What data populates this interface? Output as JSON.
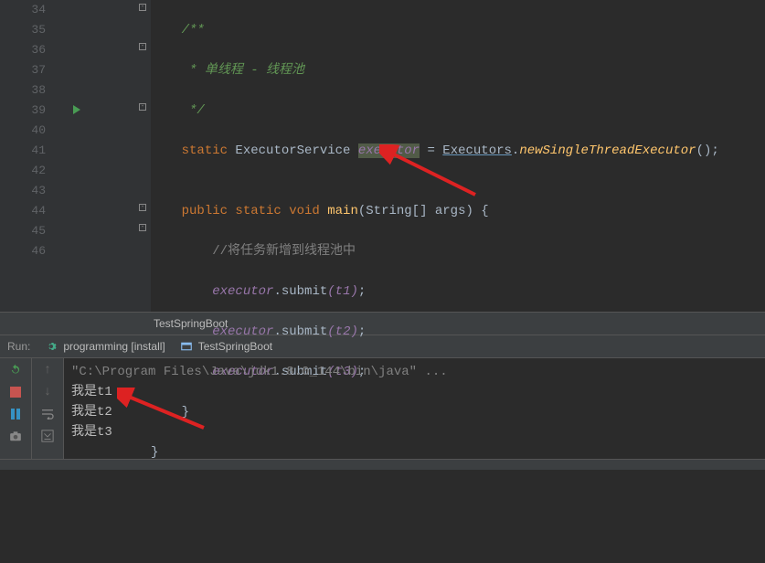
{
  "gutter_start": 34,
  "gutter_end": 46,
  "code": {
    "l34": "/**",
    "l35": " * 单线程 - 线程池",
    "l36": " */",
    "l37_kw": "static",
    "l37_type": " ExecutorService ",
    "l37_field": "executor",
    "l37_eq": " = ",
    "l37_class": "Executors",
    "l37_dot": ".",
    "l37_method": "newSingleThreadExecutor",
    "l37_tail": "();",
    "l38": "",
    "l39_kw": "public static void ",
    "l39_method": "main",
    "l39_params": "(String[] args) {",
    "l40_comment": "//将任务新增到线程池中",
    "l41_field": "executor",
    "l41_mid": ".",
    "l41_call": "submit",
    "l41_arg": "(t1)",
    "l41_tail": ";",
    "l42_field": "executor",
    "l42_mid": ".",
    "l42_call": "submit",
    "l42_arg": "(t2)",
    "l42_tail": ";",
    "l43_field": "executor",
    "l43_mid": ".",
    "l43_call": "submit",
    "l43_arg": "(t3)",
    "l43_tail": ";",
    "l44": "}",
    "l45": "}"
  },
  "breadcrumb": "TestSpringBoot",
  "run": {
    "label": "Run:",
    "config1": "programming [install]",
    "config2": "TestSpringBoot"
  },
  "console": {
    "path": "\"C:\\Program Files\\Java\\jdk1.8.0_144\\bin\\java\" ...",
    "line1": "我是t1",
    "line2": "我是t2",
    "line3": "我是t3"
  }
}
